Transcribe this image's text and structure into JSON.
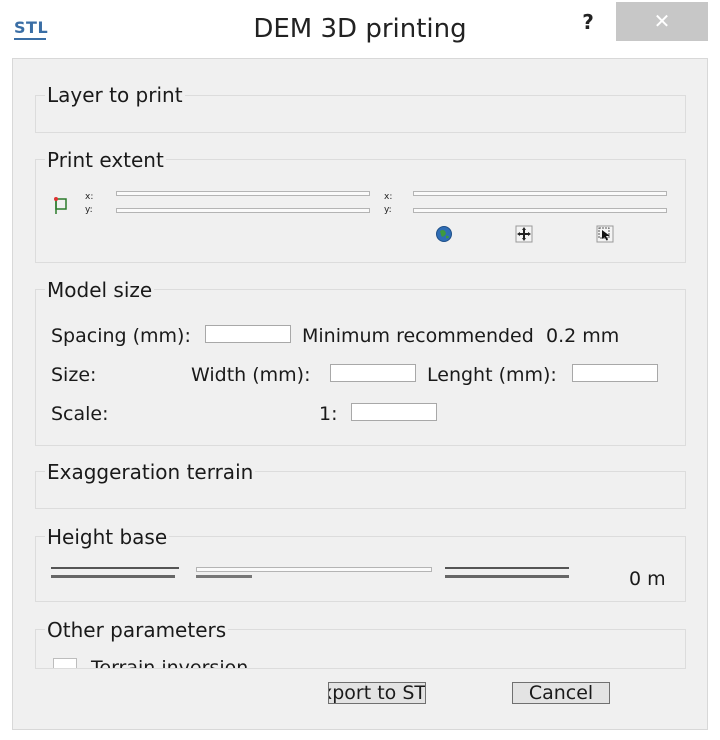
{
  "window": {
    "logo": "STL",
    "title": "DEM 3D printing",
    "help_label": "?",
    "close_label": "✕"
  },
  "layer_group": {
    "title": "Layer to print"
  },
  "extent_group": {
    "title": "Print extent",
    "icons": [
      "extent-from-layer-icon",
      "pan-extent-icon",
      "select-extent-icon"
    ]
  },
  "model_size": {
    "title": "Model size",
    "spacing_label": "Spacing (mm):",
    "spacing_value": "",
    "min_recommended_label": "Minimum recommended",
    "min_recommended_value": "0.2 mm",
    "size_label": "Size:",
    "width_label": "Width (mm):",
    "width_value": "",
    "length_label": "Lenght (mm):",
    "length_value": "",
    "scale_label": "Scale:",
    "scale_prefix": "1:",
    "scale_value": ""
  },
  "exaggeration_group": {
    "title": "Exaggeration terrain"
  },
  "height_base": {
    "title": "Height base",
    "value": "0 m"
  },
  "other_parameters": {
    "title": "Other parameters",
    "terrain_inversion_label": "Terrain inversion"
  },
  "buttons": {
    "export_label": "Export to STL",
    "cancel_label": "Cancel"
  },
  "colors": {
    "logo": "#3a6ea5",
    "close_button_bg": "#c7c7c7",
    "dialog_bg": "#f0f0f0"
  }
}
